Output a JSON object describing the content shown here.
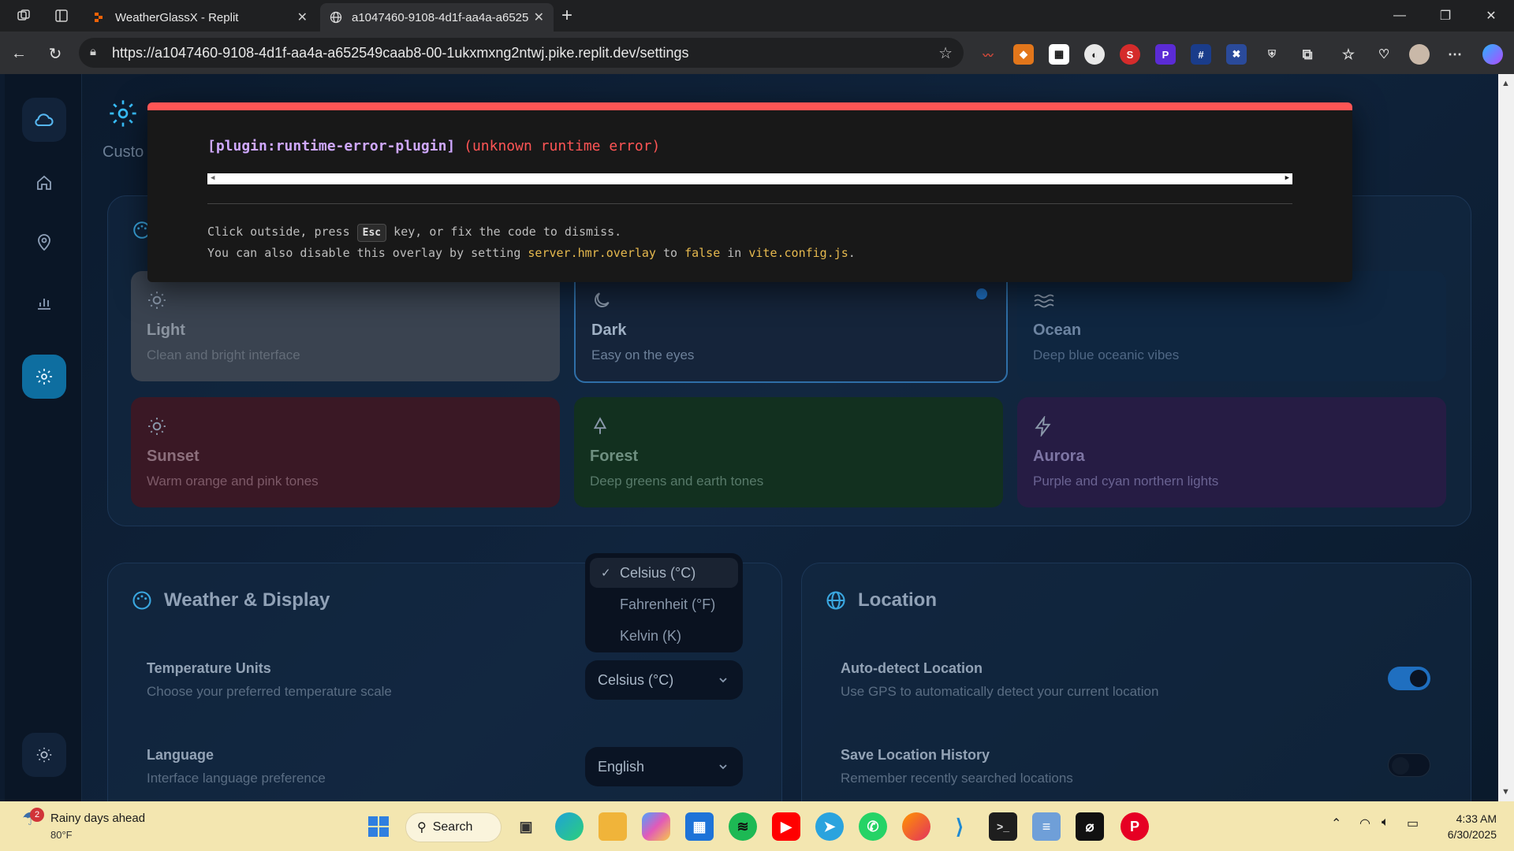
{
  "browser": {
    "tabs": [
      {
        "title": "WeatherGlassX - Replit"
      },
      {
        "title": "a1047460-9108-4d1f-aa4a-a6525"
      }
    ],
    "url": "https://a1047460-9108-4d1f-aa4a-a652549caab8-00-1ukxmxng2ntwj.pike.replit.dev/settings"
  },
  "app": {
    "page_subtitle": "Custo",
    "themes": [
      {
        "name": "Light",
        "desc": "Clean and bright interface",
        "icon": "sun-icon"
      },
      {
        "name": "Dark",
        "desc": "Easy on the eyes",
        "icon": "moon-icon"
      },
      {
        "name": "Ocean",
        "desc": "Deep blue oceanic vibes",
        "icon": "waves-icon"
      },
      {
        "name": "Sunset",
        "desc": "Warm orange and pink tones",
        "icon": "sun-icon"
      },
      {
        "name": "Forest",
        "desc": "Deep greens and earth tones",
        "icon": "tree-icon"
      },
      {
        "name": "Aurora",
        "desc": "Purple and cyan northern lights",
        "icon": "lightning-icon"
      }
    ],
    "selected_theme": "Dark",
    "weather_display": {
      "title": "Weather & Display",
      "temp_units": {
        "label": "Temperature Units",
        "desc": "Choose your preferred temperature scale",
        "value": "Celsius (°C)"
      },
      "temp_options": [
        "Celsius (°C)",
        "Fahrenheit (°F)",
        "Kelvin (K)"
      ],
      "language": {
        "label": "Language",
        "desc": "Interface language preference",
        "value": "English"
      }
    },
    "location": {
      "title": "Location",
      "auto_detect": {
        "label": "Auto-detect Location",
        "desc": "Use GPS to automatically detect your current location",
        "enabled": true
      },
      "save_history": {
        "label": "Save Location History",
        "desc": "Remember recently searched locations",
        "enabled": false
      }
    }
  },
  "error_overlay": {
    "plugin": "[plugin:runtime-error-plugin]",
    "message": "(unknown runtime error)",
    "tip1_a": "Click outside, press ",
    "tip1_key": "Esc",
    "tip1_b": " key, or fix the code to dismiss.",
    "tip2_a": "You can also disable this overlay by setting ",
    "tip2_code1": "server.hmr.overlay",
    "tip2_b": " to ",
    "tip2_code2": "false",
    "tip2_c": " in ",
    "tip2_code3": "vite.config.js",
    "tip2_d": "."
  },
  "taskbar": {
    "weather_title": "Rainy days ahead",
    "weather_temp": "80°F",
    "weather_badge": "2",
    "search_label": "Search",
    "time": "4:33 AM",
    "date": "6/30/2025"
  }
}
